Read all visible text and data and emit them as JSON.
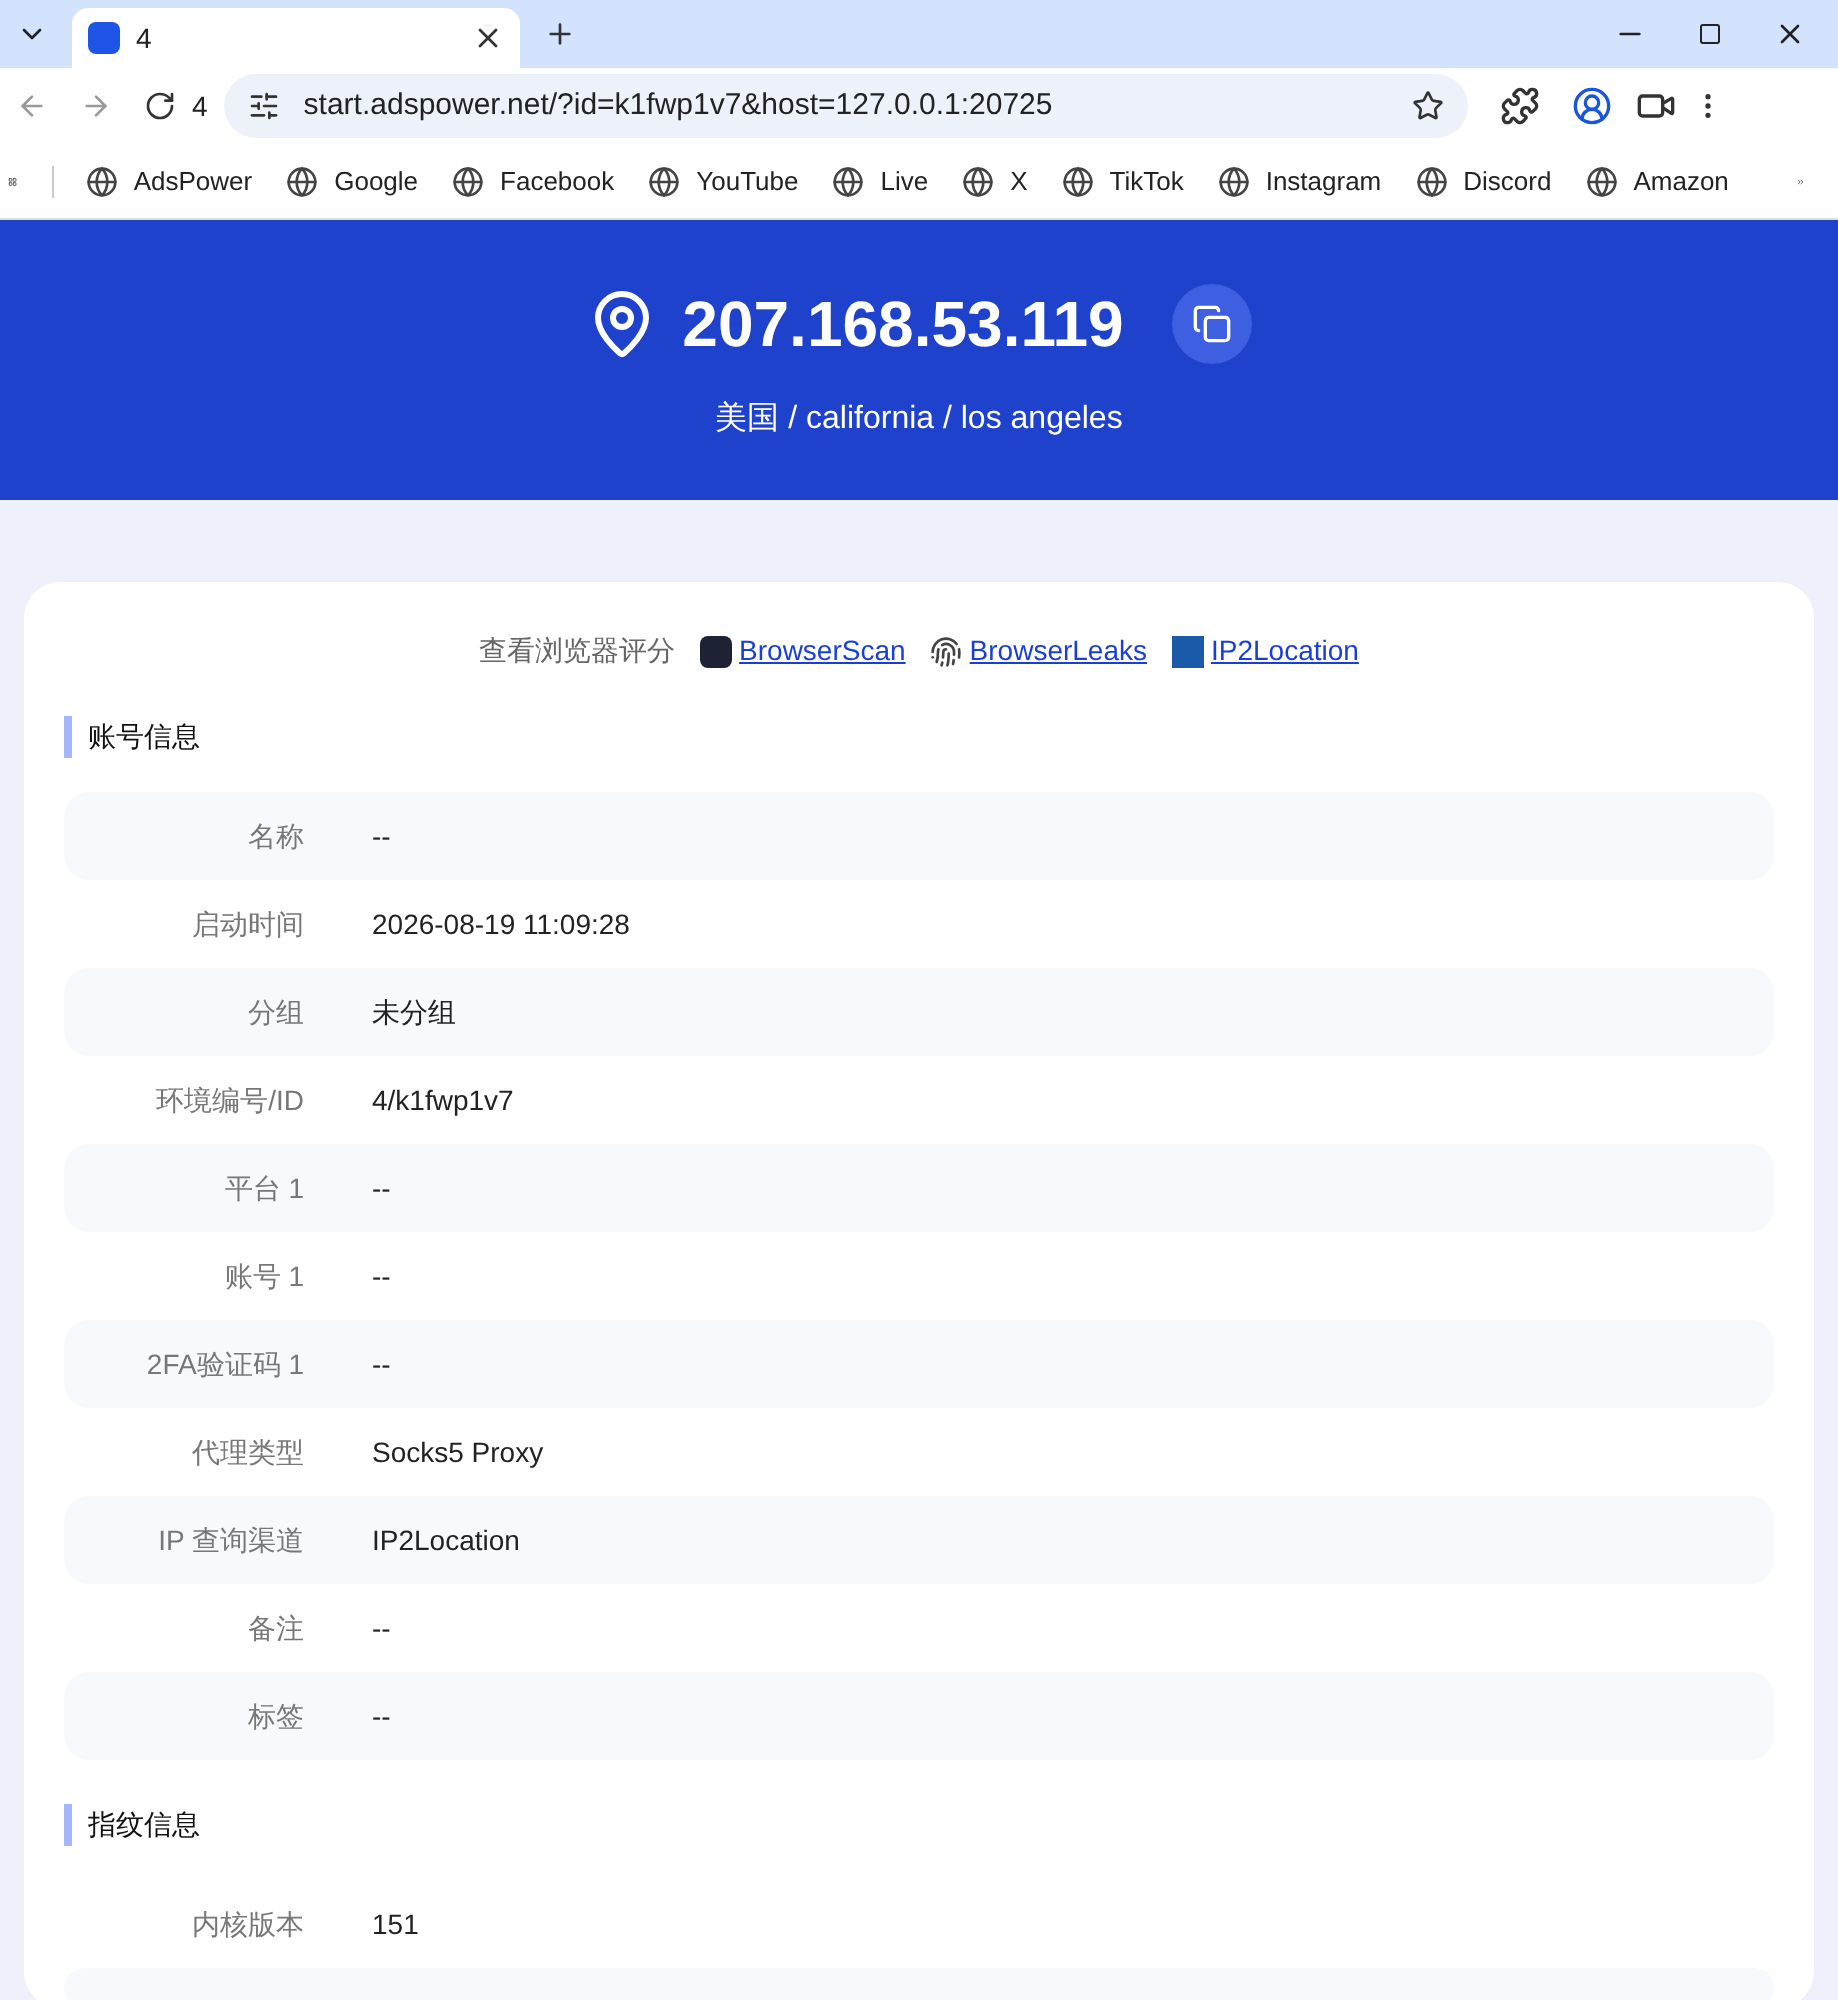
{
  "browser": {
    "tab": {
      "title": "4"
    },
    "tab_count": "4",
    "url": "start.adspower.net/?id=k1fwp1v7&host=127.0.0.1:20725",
    "bookmarks": [
      "AdsPower",
      "Google",
      "Facebook",
      "YouTube",
      "Live",
      "X",
      "TikTok",
      "Instagram",
      "Discord",
      "Amazon"
    ]
  },
  "header": {
    "ip": "207.168.53.119",
    "location": "美国 / california / los angeles"
  },
  "score": {
    "label": "查看浏览器评分",
    "links": [
      {
        "kind": "scan",
        "text": "BrowserScan"
      },
      {
        "kind": "fingerprint",
        "text": "BrowserLeaks"
      },
      {
        "kind": "ip",
        "text": "IP2Location"
      }
    ]
  },
  "sections": [
    {
      "title": "账号信息",
      "rows": [
        {
          "label": "名称",
          "value": "--"
        },
        {
          "label": "启动时间",
          "value": "2026-08-19 11:09:28"
        },
        {
          "label": "分组",
          "value": "未分组"
        },
        {
          "label": "环境编号/ID",
          "value": "4/k1fwp1v7"
        },
        {
          "label": "平台 1",
          "value": "--"
        },
        {
          "label": "账号 1",
          "value": "--"
        },
        {
          "label": "2FA验证码 1",
          "value": "--"
        },
        {
          "label": "代理类型",
          "value": "Socks5 Proxy"
        },
        {
          "label": "IP 查询渠道",
          "value": "IP2Location"
        },
        {
          "label": "备注",
          "value": "--"
        },
        {
          "label": "标签",
          "value": "--"
        }
      ]
    },
    {
      "title": "指纹信息",
      "rows": [
        {
          "label": "内核版本",
          "value": "151"
        }
      ]
    }
  ]
}
